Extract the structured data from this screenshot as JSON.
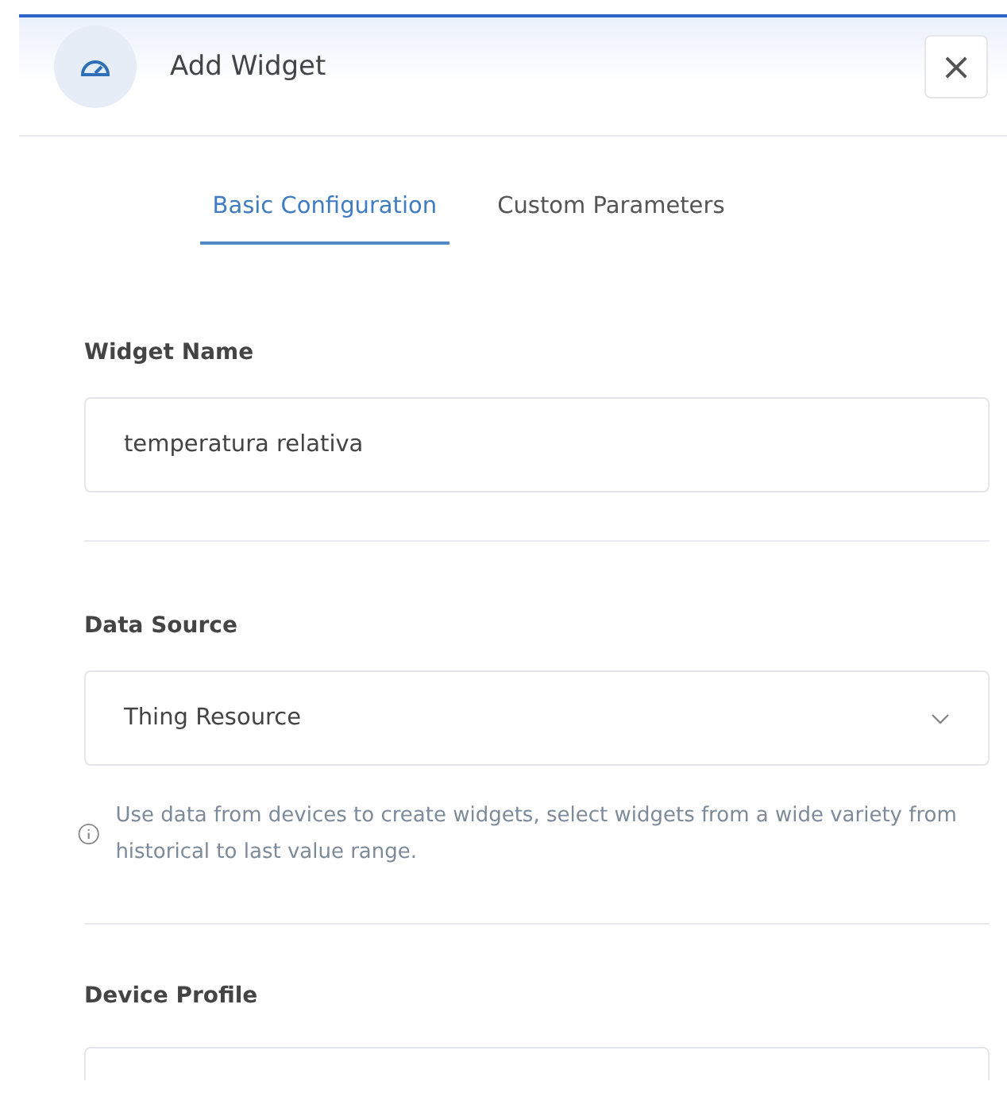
{
  "dialog": {
    "title": "Add Widget",
    "close": "×"
  },
  "tabs": [
    {
      "label": "Basic Configuration",
      "selected": true
    },
    {
      "label": "Custom Parameters",
      "selected": false
    }
  ],
  "widget_name": {
    "label": "Widget Name",
    "value": "temperatura relativa"
  },
  "data_source": {
    "label": "Data Source",
    "value": "Thing Resource",
    "info": "Use data from devices to create widgets, select widgets from a wide variety from historical to last value range."
  },
  "device_profile": {
    "label": "Device Profile"
  }
}
